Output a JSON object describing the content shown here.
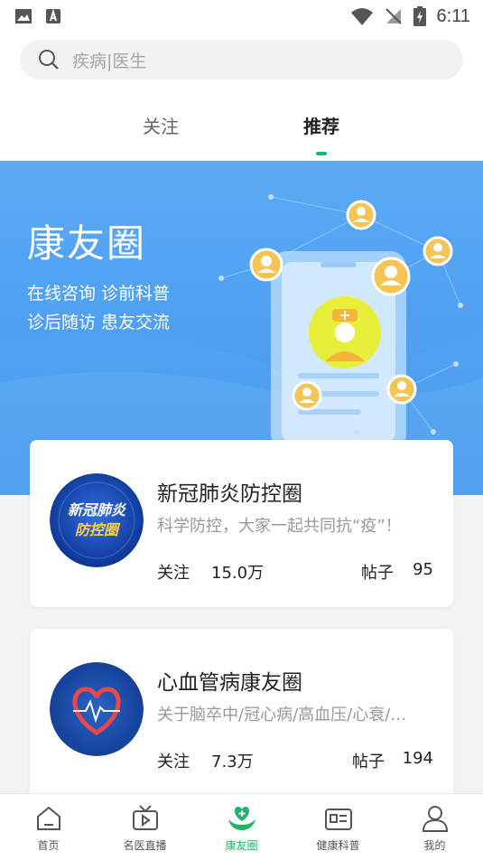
{
  "status_bar": {
    "time": "6:11"
  },
  "search": {
    "placeholder": "疾病|医生"
  },
  "tabs": [
    {
      "label": "关注",
      "active": false
    },
    {
      "label": "推荐",
      "active": true
    }
  ],
  "banner": {
    "title": "康友圈",
    "line1": "在线咨询 诊前科普",
    "line2": "诊后随访 患友交流"
  },
  "circles": [
    {
      "logo_text_1": "新冠肺炎",
      "logo_text_2": "防控圈",
      "title": "新冠肺炎防控圈",
      "desc": "科学防控，大家一起共同抗“疫”！",
      "follow_label": "关注",
      "follow_value": "15.0万",
      "posts_label": "帖子",
      "posts_value": "95"
    },
    {
      "title": "心血管病康友圈",
      "desc": "关于脑卒中/冠心病/高血压/心衰/…",
      "follow_label": "关注",
      "follow_value": "7.3万",
      "posts_label": "帖子",
      "posts_value": "194"
    }
  ],
  "bottom_nav": [
    {
      "label": "首页",
      "icon": "home-icon",
      "active": false
    },
    {
      "label": "名医直播",
      "icon": "tv-icon",
      "active": false
    },
    {
      "label": "康友圈",
      "icon": "care-hands-icon",
      "active": true
    },
    {
      "label": "健康科普",
      "icon": "news-icon",
      "active": false
    },
    {
      "label": "我的",
      "icon": "user-icon",
      "active": false
    }
  ],
  "colors": {
    "accent": "#20b46a",
    "banner_blue": "#4f9ff2",
    "page_bg": "#f3f3f3"
  }
}
